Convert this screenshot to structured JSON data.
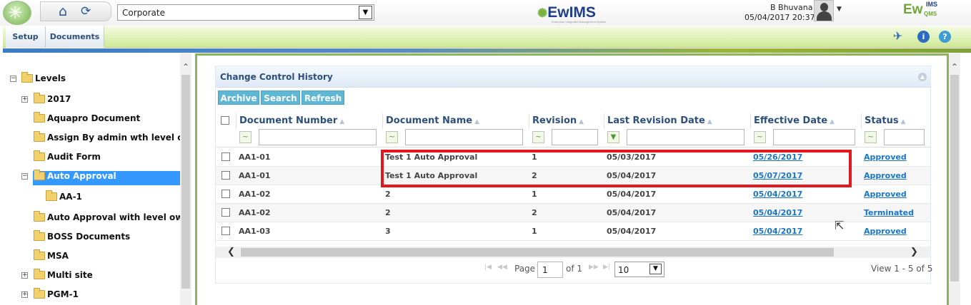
{
  "header": {
    "org_select": "Corporate",
    "brand": "EwIMS",
    "brand_tagline": "Enterprise Integrated Management System",
    "user_name": "B Bhuvana",
    "datetime": "05/04/2017 20:37",
    "brand2": "Ew",
    "brand2_sup": "IMS",
    "brand2_sub": "QMS"
  },
  "menu": {
    "setup": "Setup",
    "documents": "Documents"
  },
  "tree": [
    {
      "label": "Levels",
      "expander": "−",
      "selected": false
    },
    {
      "label": "2017",
      "expander": "+",
      "selected": false
    },
    {
      "label": "Aquapro Document",
      "expander": "",
      "selected": false
    },
    {
      "label": "Assign By admin wth level owner",
      "expander": "",
      "selected": false
    },
    {
      "label": "Audit Form",
      "expander": "",
      "selected": false
    },
    {
      "label": "Auto Approval",
      "expander": "−",
      "selected": true
    },
    {
      "label": "AA-1",
      "expander": "",
      "selected": false
    },
    {
      "label": "Auto Approval with level owner",
      "expander": "",
      "selected": false
    },
    {
      "label": "BOSS Documents",
      "expander": "",
      "selected": false
    },
    {
      "label": "MSA",
      "expander": "",
      "selected": false
    },
    {
      "label": "Multi site",
      "expander": "+",
      "selected": false
    },
    {
      "label": "PGM-1",
      "expander": "+",
      "selected": false
    }
  ],
  "panel": {
    "title": "Change Control History",
    "buttons": {
      "archive": "Archive",
      "search": "Search",
      "refresh": "Refresh"
    }
  },
  "grid": {
    "columns": [
      "Document Number",
      "Document Name",
      "Revision",
      "Last Revision Date",
      "Effective Date",
      "Status"
    ],
    "rows": [
      [
        "AA1-01",
        "Test 1 Auto Approval",
        "1",
        "05/03/2017",
        "05/26/2017",
        "Approved"
      ],
      [
        "AA1-01",
        "Test 1 Auto Approval",
        "2",
        "05/04/2017",
        "05/07/2017",
        "Approved"
      ],
      [
        "AA1-02",
        "2",
        "1",
        "05/04/2017",
        "05/04/2017",
        "Approved"
      ],
      [
        "AA1-02",
        "2",
        "2",
        "05/04/2017",
        "05/04/2017",
        "Terminated"
      ],
      [
        "AA1-03",
        "3",
        "1",
        "05/04/2017",
        "05/04/2017",
        "Approved"
      ]
    ]
  },
  "pager": {
    "page_label": "Page",
    "page_value": "1",
    "of_label": "of 1",
    "page_size": "10",
    "view_text": "View 1 - 5 of 5"
  }
}
